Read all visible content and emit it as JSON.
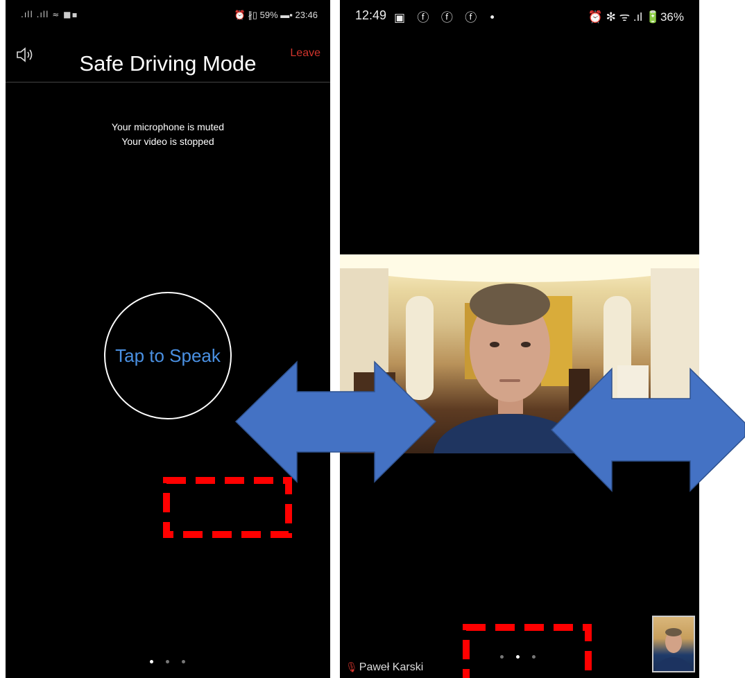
{
  "left_phone": {
    "status": {
      "left_icons": ".ıll .ıll ≈ ■▪",
      "right_text": "⏰ ∦▯ 59% ▬▪ 23:46"
    },
    "header": {
      "title": "Safe Driving Mode",
      "leave_label": "Leave",
      "speaker_icon": "speaker-icon"
    },
    "messages": {
      "mic": "Your microphone is muted",
      "video": "Your video is stopped"
    },
    "speak_button_label": "Tap to Speak",
    "page_indicator": {
      "count": 3,
      "active": 0
    }
  },
  "right_phone": {
    "status": {
      "time": "12:49",
      "left_icons": "▣ ⓕ ⓕ ⓕ •",
      "right_text": "⏰ ✻ ᯤ .ıl 🔋36%"
    },
    "participant_name": "Paweł Karski",
    "page_indicator": {
      "count": 3,
      "active": 1
    }
  },
  "annotations": {
    "arrow_color": "#4472c4",
    "highlight_color": "#ff0000"
  }
}
